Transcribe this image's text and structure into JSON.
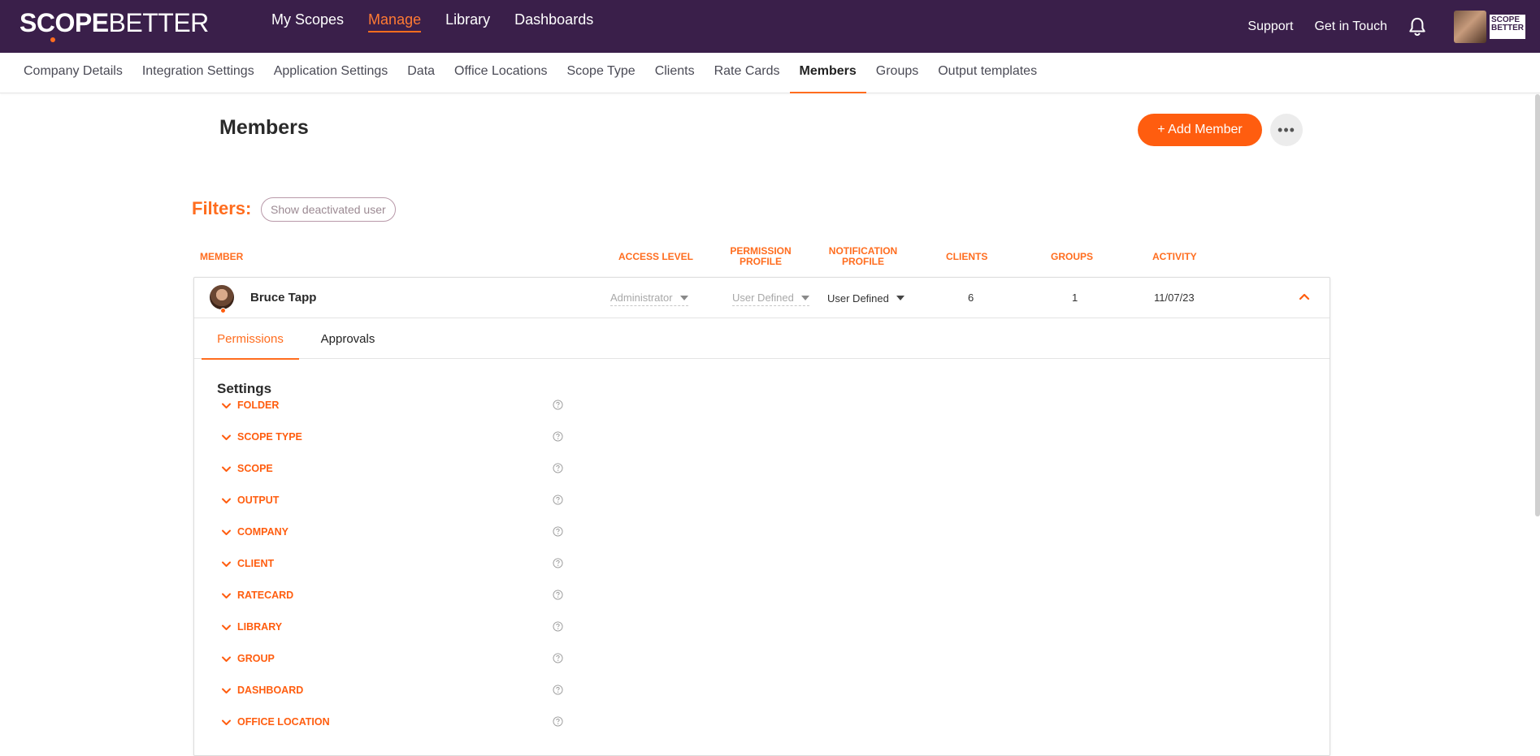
{
  "brand": {
    "name_part1": "SCOPE",
    "name_part2": "BETTER",
    "mini_logo_text": "SCOPE BETTER"
  },
  "main_nav": [
    {
      "label": "My Scopes",
      "active": false
    },
    {
      "label": "Manage",
      "active": true
    },
    {
      "label": "Library",
      "active": false
    },
    {
      "label": "Dashboards",
      "active": false
    }
  ],
  "top_right": {
    "support": "Support",
    "get_in_touch": "Get in Touch",
    "bell_icon": "bell-icon"
  },
  "sub_nav": [
    {
      "label": "Company Details",
      "active": false
    },
    {
      "label": "Integration Settings",
      "active": false
    },
    {
      "label": "Application Settings",
      "active": false
    },
    {
      "label": "Data",
      "active": false
    },
    {
      "label": "Office Locations",
      "active": false
    },
    {
      "label": "Scope Type",
      "active": false
    },
    {
      "label": "Clients",
      "active": false
    },
    {
      "label": "Rate Cards",
      "active": false
    },
    {
      "label": "Members",
      "active": true
    },
    {
      "label": "Groups",
      "active": false
    },
    {
      "label": "Output templates",
      "active": false
    }
  ],
  "page": {
    "title": "Members",
    "add_button": "+ Add Member",
    "more_icon": "•••"
  },
  "filters": {
    "label": "Filters:",
    "pill": "Show deactivated user"
  },
  "table": {
    "headers": {
      "member": "MEMBER",
      "access_level": "ACCESS LEVEL",
      "permission_profile_1": "PERMISSION",
      "permission_profile_2": "PROFILE",
      "notification_profile_1": "NOTIFICATION",
      "notification_profile_2": "PROFILE",
      "clients": "CLIENTS",
      "groups": "GROUPS",
      "activity": "ACTIVITY"
    },
    "member": {
      "name": "Bruce Tapp",
      "access_level": "Administrator",
      "permission_profile": "User Defined",
      "notification_profile": "User Defined",
      "clients": "6",
      "groups": "1",
      "activity": "11/07/23"
    }
  },
  "detail_tabs": [
    {
      "label": "Permissions",
      "active": true
    },
    {
      "label": "Approvals",
      "active": false
    }
  ],
  "settings": {
    "title": "Settings",
    "items": [
      "FOLDER",
      "SCOPE TYPE",
      "SCOPE",
      "OUTPUT",
      "COMPANY",
      "CLIENT",
      "RATECARD",
      "LIBRARY",
      "GROUP",
      "DASHBOARD",
      "OFFICE LOCATION"
    ]
  },
  "colors": {
    "topbar": "#3a1f4a",
    "accent": "#ff5d0f"
  }
}
